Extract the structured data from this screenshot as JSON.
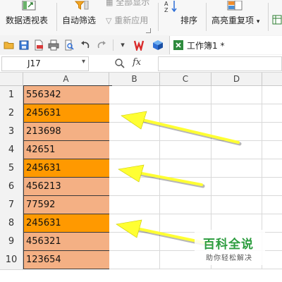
{
  "ribbon": {
    "pivot_table": "数据透视表",
    "auto_filter": "自动筛选",
    "show_all": "全部显示",
    "reapply": "重新应用",
    "sort": "排序",
    "highlight_duplicates": "高亮重复项",
    "highlight_caret": "▾"
  },
  "quick_access": {
    "doc_title": "工作簿1 *",
    "dropdown_caret": "▾"
  },
  "formula_bar": {
    "name_box": "J17",
    "name_caret": "▾",
    "fx": "fx",
    "formula": ""
  },
  "sheet": {
    "columns": [
      "A",
      "B",
      "C",
      "D"
    ],
    "rows": [
      {
        "num": "1",
        "value": "556342",
        "highlight": false
      },
      {
        "num": "2",
        "value": "245631",
        "highlight": true
      },
      {
        "num": "3",
        "value": "213698",
        "highlight": false
      },
      {
        "num": "4",
        "value": "42651",
        "highlight": false
      },
      {
        "num": "5",
        "value": "245631",
        "highlight": true
      },
      {
        "num": "6",
        "value": "456213",
        "highlight": false
      },
      {
        "num": "7",
        "value": "77592",
        "highlight": false
      },
      {
        "num": "8",
        "value": "245631",
        "highlight": true
      },
      {
        "num": "9",
        "value": "456321",
        "highlight": false
      },
      {
        "num": "10",
        "value": "123654",
        "highlight": false
      }
    ]
  },
  "colors": {
    "cell_fill": "#F4B084",
    "duplicate_fill": "#FF9900",
    "arrow": "#FFFF33"
  },
  "watermark": {
    "title": "百科全说",
    "subtitle": "助你轻松解决"
  }
}
